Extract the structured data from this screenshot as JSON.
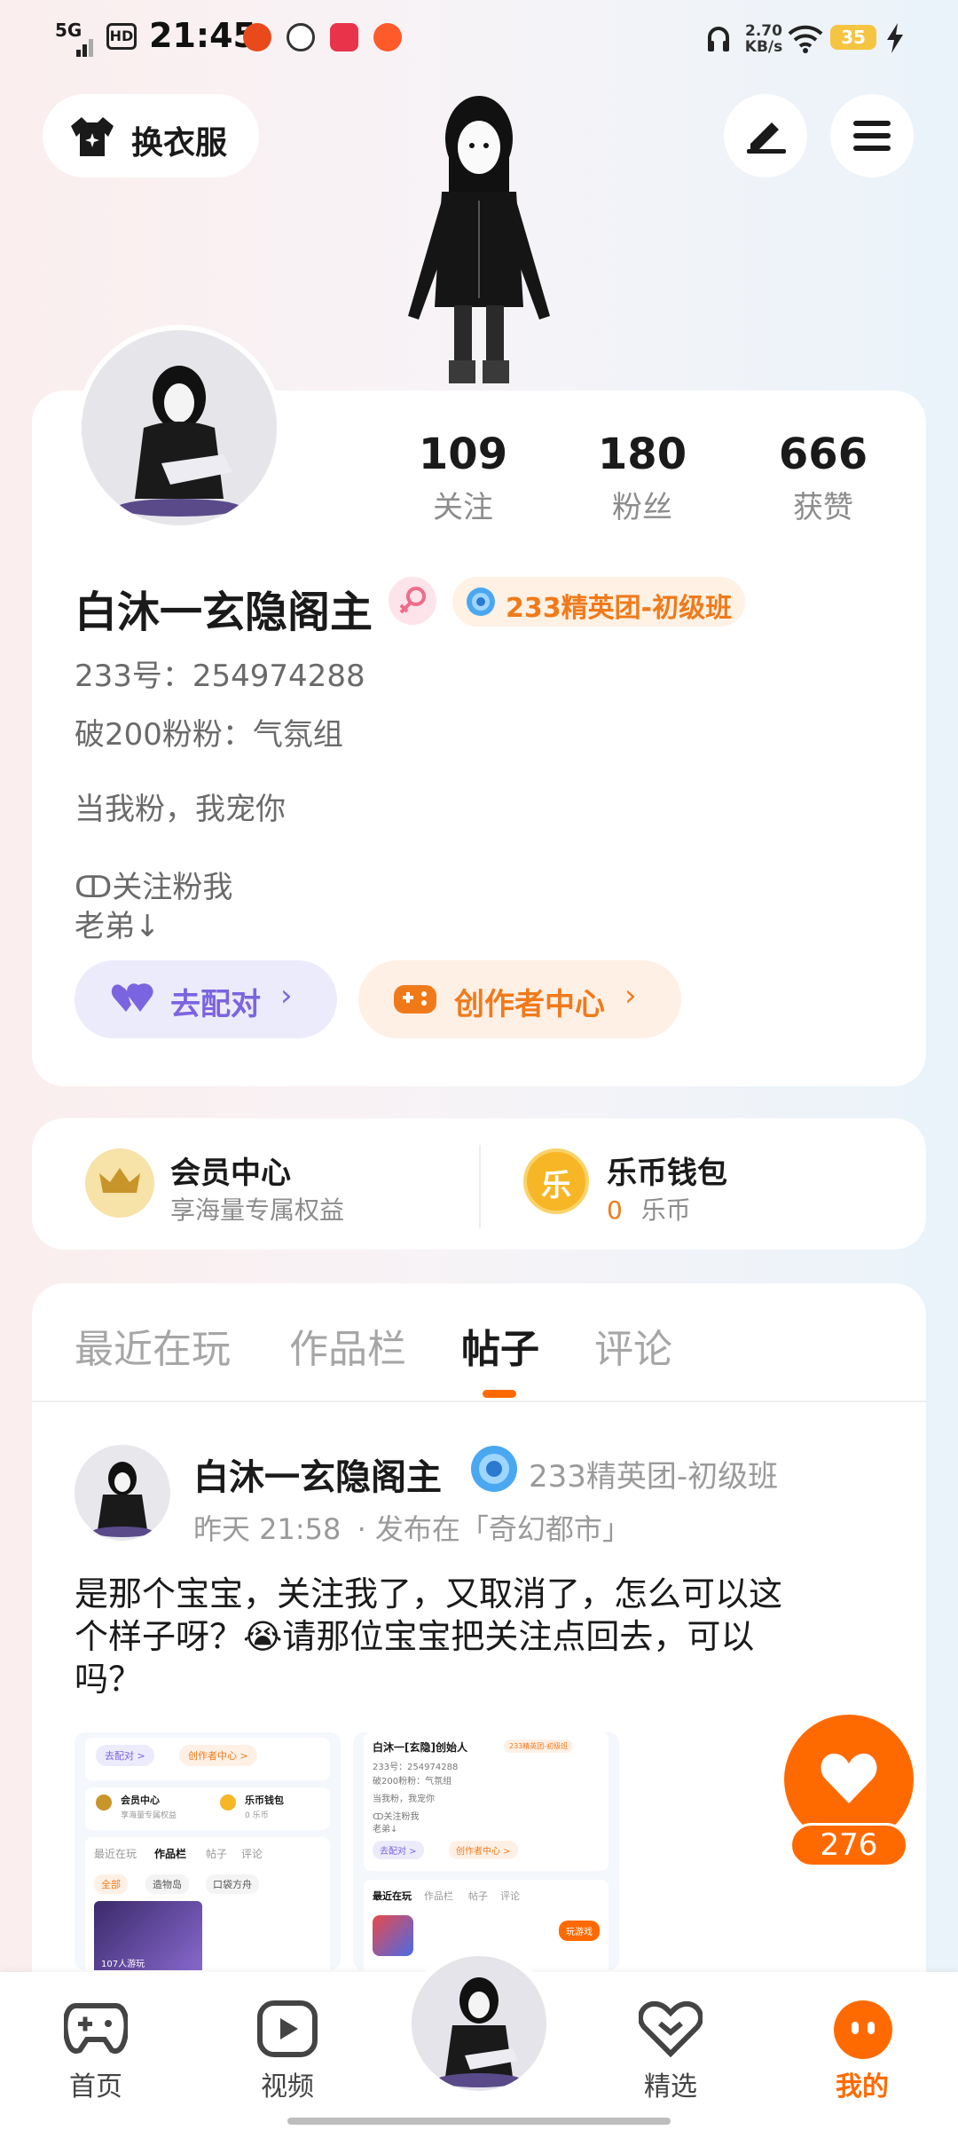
{
  "status_bar": {
    "signal": "5G",
    "hd": "HD",
    "time": "21:45",
    "net_speed_value": "2.70",
    "net_speed_unit": "KB/s",
    "battery": "35"
  },
  "top_bar": {
    "outfit_label": "换衣服"
  },
  "profile": {
    "stats": [
      {
        "value": "109",
        "label": "关注"
      },
      {
        "value": "180",
        "label": "粉丝"
      },
      {
        "value": "666",
        "label": "获赞"
      }
    ],
    "name": "白沐一玄隐阁主",
    "badge": "233精英团-初级班",
    "id_line": "233号：254974288",
    "group_line": "破200粉粉：气氛组",
    "bio_line1": "当我粉，我宠你",
    "bio_line2": "ↀ关注粉我",
    "bio_line3": "老弟↓",
    "match_button": "去配对",
    "creator_button": "创作者中心"
  },
  "services": {
    "vip_title": "会员中心",
    "vip_subtitle": "享海量专属权益",
    "wallet_title": "乐币钱包",
    "wallet_amount": "0",
    "wallet_unit": "乐币"
  },
  "tabs": [
    "最近在玩",
    "作品栏",
    "帖子",
    "评论"
  ],
  "active_tab": 2,
  "post": {
    "author": "白沐一玄隐阁主",
    "badge": "233精英团-初级班",
    "time": "昨天  21:58",
    "published_in": "· 发布在「奇幻都市」",
    "text_line1": "是那个宝宝，关注我了，又取消了，怎么可以这",
    "text_line2": "个样子呀？😭请那位宝宝把关注点回去，可以",
    "text_line3": "吗？",
    "like_count": "276"
  },
  "thumb_left": {
    "match": "去配对 >",
    "creator": "创作者中心 >",
    "vip": "会员中心",
    "vip_sub": "享海量专属权益",
    "wallet": "乐币钱包",
    "wallet_sub": "0 乐币",
    "tabs": [
      "最近在玩",
      "作品栏",
      "帖子",
      "评论"
    ],
    "chips": [
      "全部",
      "造物岛",
      "口袋方舟"
    ],
    "play_count": "107人游玩"
  },
  "thumb_right": {
    "name": "白沐一[玄隐]创始人",
    "badge": "233精英团-初级班",
    "id": "233号：254974288",
    "group": "破200粉粉：气氛组",
    "bio1": "当我粉，我宠你",
    "bio2": "ↀ关注粉我",
    "bio3": "老弟↓",
    "match": "去配对 >",
    "creator": "创作者中心 >",
    "tabs": [
      "最近在玩",
      "作品栏",
      "帖子",
      "评论"
    ],
    "play_button": "玩游戏"
  },
  "bottom_nav": {
    "home": "首页",
    "video": "视频",
    "featured": "精选",
    "mine": "我的"
  },
  "colors": {
    "accent_orange": "#ff6a00",
    "badge_orange": "#f07a1a",
    "purple": "#7b64e0",
    "purple_bg": "#ecebfb",
    "orange_bg": "#fff0e6"
  }
}
